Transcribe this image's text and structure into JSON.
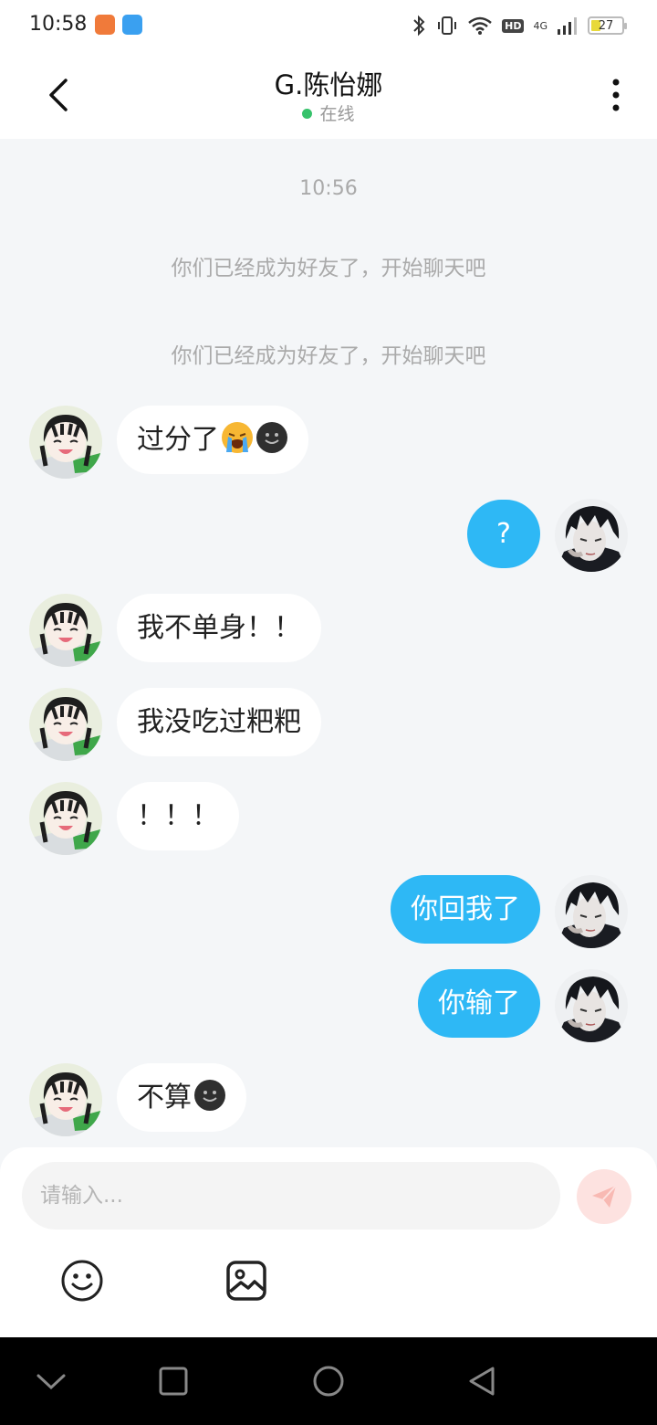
{
  "status_bar": {
    "time": "10:58",
    "battery_level": "27",
    "network": "4G",
    "hd_label": "HD"
  },
  "header": {
    "title": "G.陈怡娜",
    "status": "在线",
    "status_color": "#36c26b"
  },
  "chat": {
    "timestamp": "10:56",
    "system_messages": [
      "你们已经成为好友了，开始聊天吧",
      "你们已经成为好友了，开始聊天吧"
    ],
    "messages": [
      {
        "side": "in",
        "text": "过分了",
        "emojis": [
          "loudly-crying-emoji",
          "smiling-dark-emoji"
        ]
      },
      {
        "side": "out",
        "text": "?"
      },
      {
        "side": "in",
        "text": "我不单身！！"
      },
      {
        "side": "in",
        "text": "我没吃过粑粑"
      },
      {
        "side": "in",
        "text": "！！！"
      },
      {
        "side": "out",
        "text": "你回我了"
      },
      {
        "side": "out",
        "text": "你输了"
      },
      {
        "side": "in",
        "text": "不算",
        "emojis": [
          "smiling-dark-emoji"
        ]
      }
    ],
    "outgoing_bubble_color": "#2eb8f5",
    "incoming_bubble_color": "#ffffff"
  },
  "composer": {
    "placeholder": "请输入...",
    "value": "",
    "send_icon": "paper-plane-icon",
    "tools": [
      "emoji-icon",
      "image-icon"
    ]
  },
  "nav_bar": {
    "buttons": [
      "chevron-down-icon",
      "square-icon",
      "circle-icon",
      "triangle-back-icon"
    ]
  }
}
